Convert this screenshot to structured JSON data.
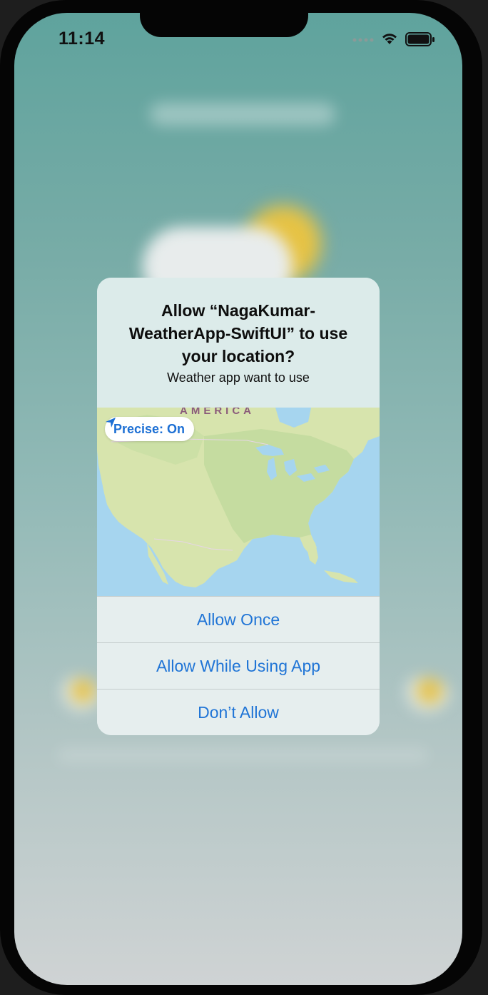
{
  "status_bar": {
    "time": "11:14",
    "signal_icon": "cellular-dots-icon",
    "wifi_icon": "wifi-icon",
    "battery_icon": "battery-icon"
  },
  "alert": {
    "title": "Allow “NagaKumar-WeatherApp-SwiftUI” to use your location?",
    "message": "Weather app want to use",
    "map": {
      "region_label": "AMERICA",
      "precise_label": "Precise: On",
      "precise_icon": "location-arrow-icon"
    },
    "buttons": {
      "allow_once": "Allow Once",
      "allow_while_using": "Allow While Using App",
      "dont_allow": "Don’t Allow"
    }
  },
  "colors": {
    "accent": "#1f74d6",
    "background_top": "#5fa39d",
    "background_bottom": "#cfd3d4"
  }
}
